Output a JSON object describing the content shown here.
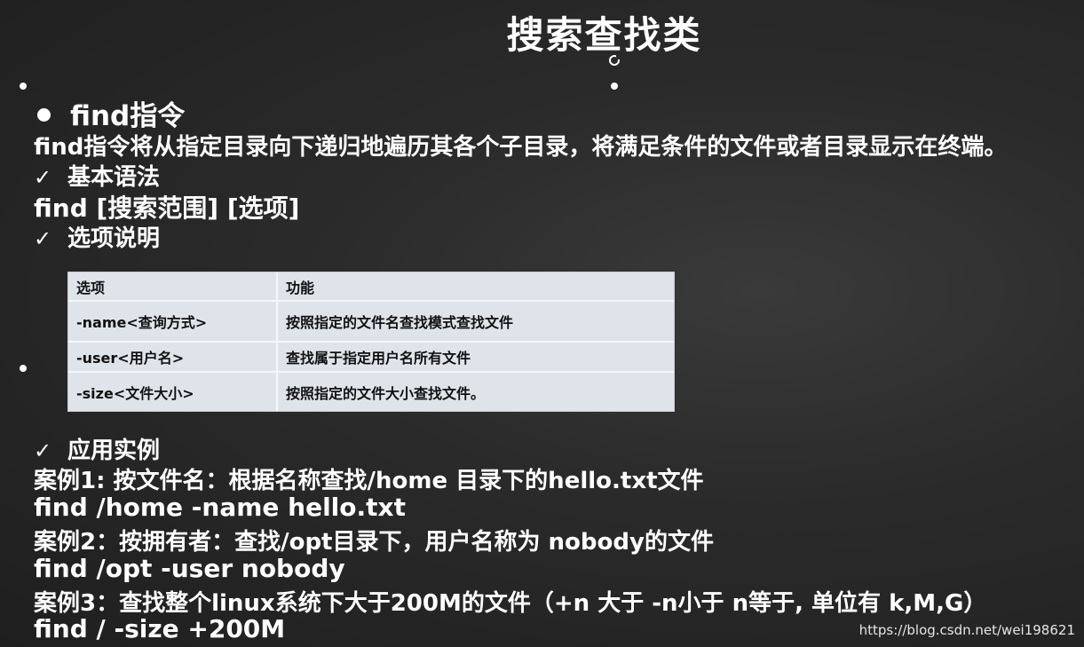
{
  "title": "搜索查找类",
  "section_heading": "find指令",
  "description": "find指令将从指定目录向下递归地遍历其各个子目录，将满足条件的文件或者目录显示在终端。",
  "syntax": {
    "heading": "基本语法",
    "line": "find  [搜索范围]  [选项]"
  },
  "options": {
    "heading": "选项说明",
    "headers": [
      "选项",
      "功能"
    ],
    "rows": [
      [
        "-name<查询方式>",
        "按照指定的文件名查找模式查找文件"
      ],
      [
        "-user<用户名>",
        "查找属于指定用户名所有文件"
      ],
      [
        "-size<文件大小>",
        "按照指定的文件大小查找文件。"
      ]
    ]
  },
  "examples": {
    "heading": "应用实例",
    "lines": [
      "案例1: 按文件名：根据名称查找/home 目录下的hello.txt文件",
      "find /home -name hello.txt",
      "案例2：按拥有者：查找/opt目录下，用户名称为 nobody的文件",
      "find /opt -user nobody",
      "案例3：查找整个linux系统下大于200M的文件（+n 大于  -n小于   n等于, 单位有 k,M,G）",
      "find / -size +200M"
    ]
  },
  "watermark": "https://blog.csdn.net/wei198621"
}
